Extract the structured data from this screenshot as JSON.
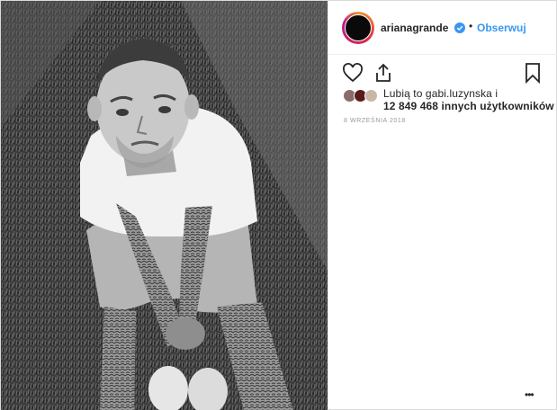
{
  "post": {
    "image_alt": "black and white photo of a man sitting on grass",
    "username": "arianagrande",
    "verified_icon": "verified-badge-icon",
    "separator": "•",
    "follow_label": "Obserwuj",
    "likes_line1": "Lubią to gabi.luzynska i",
    "likes_line2": "12 849 468 innych użytkowników",
    "date": "8 WRZEŚNIA 2018",
    "more_label": "•••"
  },
  "actions": {
    "like_icon": "heart-icon",
    "share_icon": "share-icon",
    "save_icon": "bookmark-icon"
  },
  "colors": {
    "accent": "#3897f0",
    "text": "#262626",
    "muted": "#999999",
    "border": "#efefef"
  }
}
